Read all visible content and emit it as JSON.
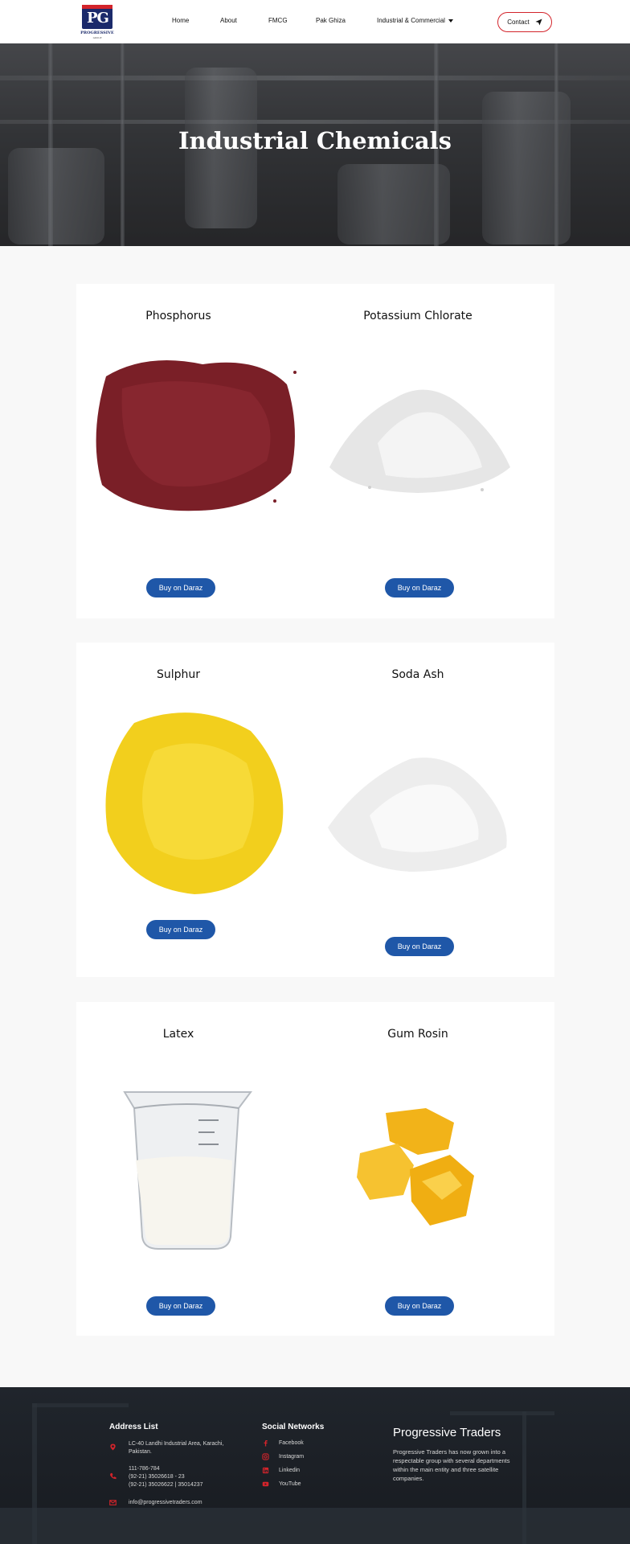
{
  "header": {
    "logo_mark": "PG",
    "logo_name": "PROGRESSIVE",
    "logo_sub": "GROUP",
    "nav": {
      "home": "Home",
      "about": "About",
      "fmcg": "FMCG",
      "pak_ghiza": "Pak Ghiza",
      "industrial": "Industrial & Commercial"
    },
    "contact_label": "Contact"
  },
  "hero": {
    "title": "Industrial Chemicals"
  },
  "products": [
    {
      "name": "Phosphorus",
      "button": "Buy on Daraz"
    },
    {
      "name": "Potassium Chlorate",
      "button": "Buy on Daraz"
    },
    {
      "name": "Sulphur",
      "button": "Buy on Daraz"
    },
    {
      "name": "Soda Ash",
      "button": "Buy on Daraz"
    },
    {
      "name": "Latex",
      "button": "Buy on Daraz"
    },
    {
      "name": "Gum Rosin",
      "button": "Buy on Daraz"
    }
  ],
  "footer": {
    "address_heading": "Address List",
    "address_line1": "LC-40 Landhi Industrial Area, Karachi,",
    "address_line2": "Pakistan.",
    "phone1": "111-786-784",
    "phone2": "(92-21) 35026618 - 23",
    "phone3": "(92-21) 35026622 | 35014237",
    "email": "info@progressivetraders.com",
    "social_heading": "Social Networks",
    "social": {
      "facebook": "Facebook",
      "instagram": "Instagram",
      "linkedin": "Linkedin",
      "youtube": "YouTube"
    },
    "brand_heading": "Progressive Traders",
    "brand_text": "Progressive Traders has now grown into a respectable group with several departments within the main entity and three satellite companies."
  },
  "colors": {
    "accent_red": "#d3242b",
    "button_blue": "#1f57a8",
    "brand_navy": "#1b2a6b",
    "footer_bg": "#1c2026"
  }
}
